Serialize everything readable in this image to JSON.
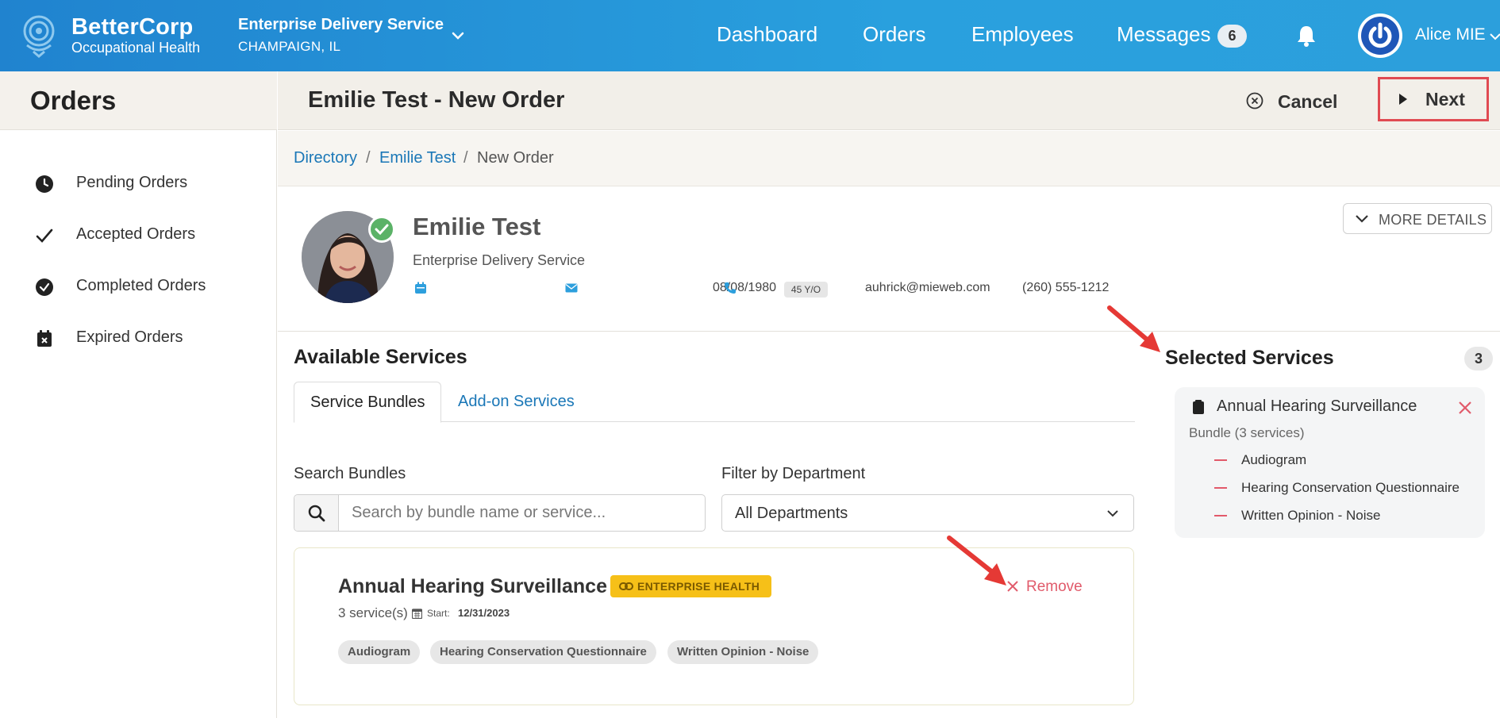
{
  "topbar": {
    "brand_name": "BetterCorp",
    "brand_sub": "Occupational Health",
    "org_name": "Enterprise Delivery Service",
    "org_location": "CHAMPAIGN, IL",
    "nav": [
      "Dashboard",
      "Orders",
      "Employees",
      "Messages"
    ],
    "messages_count": "6",
    "user_name": "Alice MIE",
    "brand_color": "#2490d6"
  },
  "sidebar": {
    "title": "Orders",
    "items": [
      {
        "label": "Pending Orders",
        "icon": "clock-icon"
      },
      {
        "label": "Accepted Orders",
        "icon": "check-icon"
      },
      {
        "label": "Completed Orders",
        "icon": "check-circle-icon"
      },
      {
        "label": "Expired Orders",
        "icon": "calendar-x-icon"
      }
    ]
  },
  "header": {
    "title": "Emilie Test - New Order",
    "cancel_label": "Cancel",
    "next_label": "Next"
  },
  "breadcrumb": {
    "items": [
      "Directory",
      "Emilie Test",
      "New Order"
    ],
    "separator": "/"
  },
  "profile": {
    "name": "Emilie Test",
    "org": "Enterprise Delivery Service",
    "dob": "08/08/1980",
    "age": "45 Y/O",
    "email": "auhrick@mieweb.com",
    "phone": "(260) 555-1212",
    "more_details_label": "MORE DETAILS"
  },
  "available": {
    "title": "Available Services",
    "tabs": [
      "Service Bundles",
      "Add-on Services"
    ],
    "active_tab": "Service Bundles",
    "search_label": "Search Bundles",
    "search_placeholder": "Search by bundle name or service...",
    "filter_label": "Filter by Department",
    "filter_value": "All Departments",
    "bundle": {
      "name": "Annual Hearing Surveillance",
      "badge": "ENTERPRISE HEALTH",
      "count": "3 service(s)",
      "start_label": "Start:",
      "start_date": "12/31/2023",
      "remove_label": "Remove",
      "services": [
        "Audiogram",
        "Hearing Conservation Questionnaire",
        "Written Opinion - Noise"
      ]
    }
  },
  "selected": {
    "title": "Selected Services",
    "count": "3",
    "bundle_name": "Annual Hearing Surveillance",
    "bundle_sub": "Bundle (3 services)",
    "items": [
      "Audiogram",
      "Hearing Conservation Questionnaire",
      "Written Opinion - Noise"
    ]
  },
  "colors": {
    "accent_link": "#1a77b7",
    "danger": "#e15b6b",
    "badge_yellow": "#f6c018",
    "annotation_red": "#e53935"
  }
}
